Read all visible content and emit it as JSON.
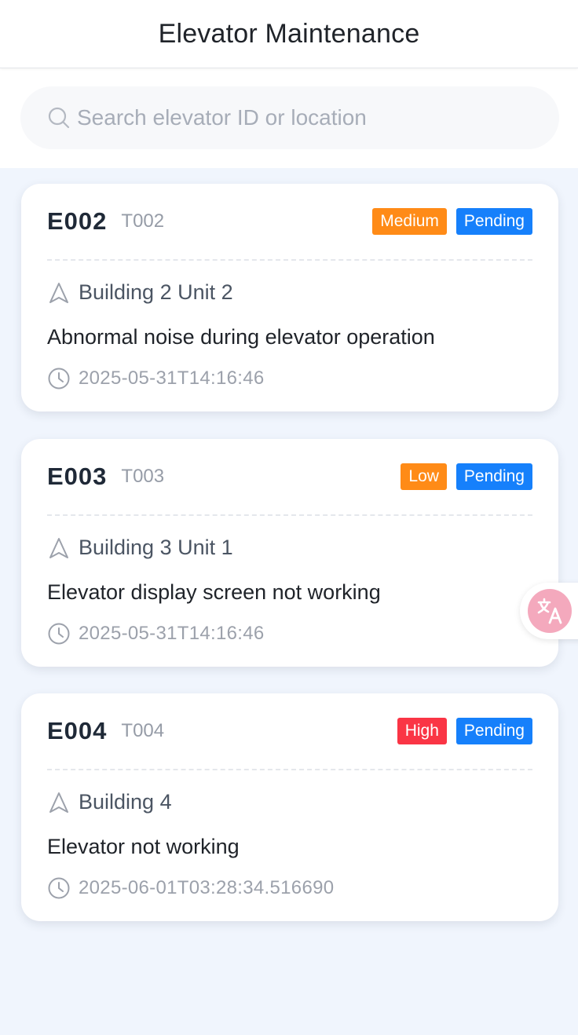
{
  "header": {
    "title": "Elevator Maintenance"
  },
  "search": {
    "placeholder": "Search elevator ID or location",
    "value": ""
  },
  "icons": {
    "search": "search-icon",
    "location": "navigation-arrow-icon",
    "time": "clock-icon",
    "translate": "translate-icon"
  },
  "colors": {
    "medium": "#ff8b17",
    "low": "#ff8b17",
    "high": "#fa3545",
    "pending": "#1680fb"
  },
  "tickets": [
    {
      "elevator_id": "E002",
      "ticket_id": "T002",
      "priority": "Medium",
      "status": "Pending",
      "location": "Building 2 Unit 2",
      "description": "Abnormal noise during elevator operation",
      "time": "2025-05-31T14:16:46"
    },
    {
      "elevator_id": "E003",
      "ticket_id": "T003",
      "priority": "Low",
      "status": "Pending",
      "location": "Building 3 Unit 1",
      "description": "Elevator display screen not working",
      "time": "2025-05-31T14:16:46"
    },
    {
      "elevator_id": "E004",
      "ticket_id": "T004",
      "priority": "High",
      "status": "Pending",
      "location": "Building 4",
      "description": "Elevator not working",
      "time": "2025-06-01T03:28:34.516690"
    }
  ]
}
